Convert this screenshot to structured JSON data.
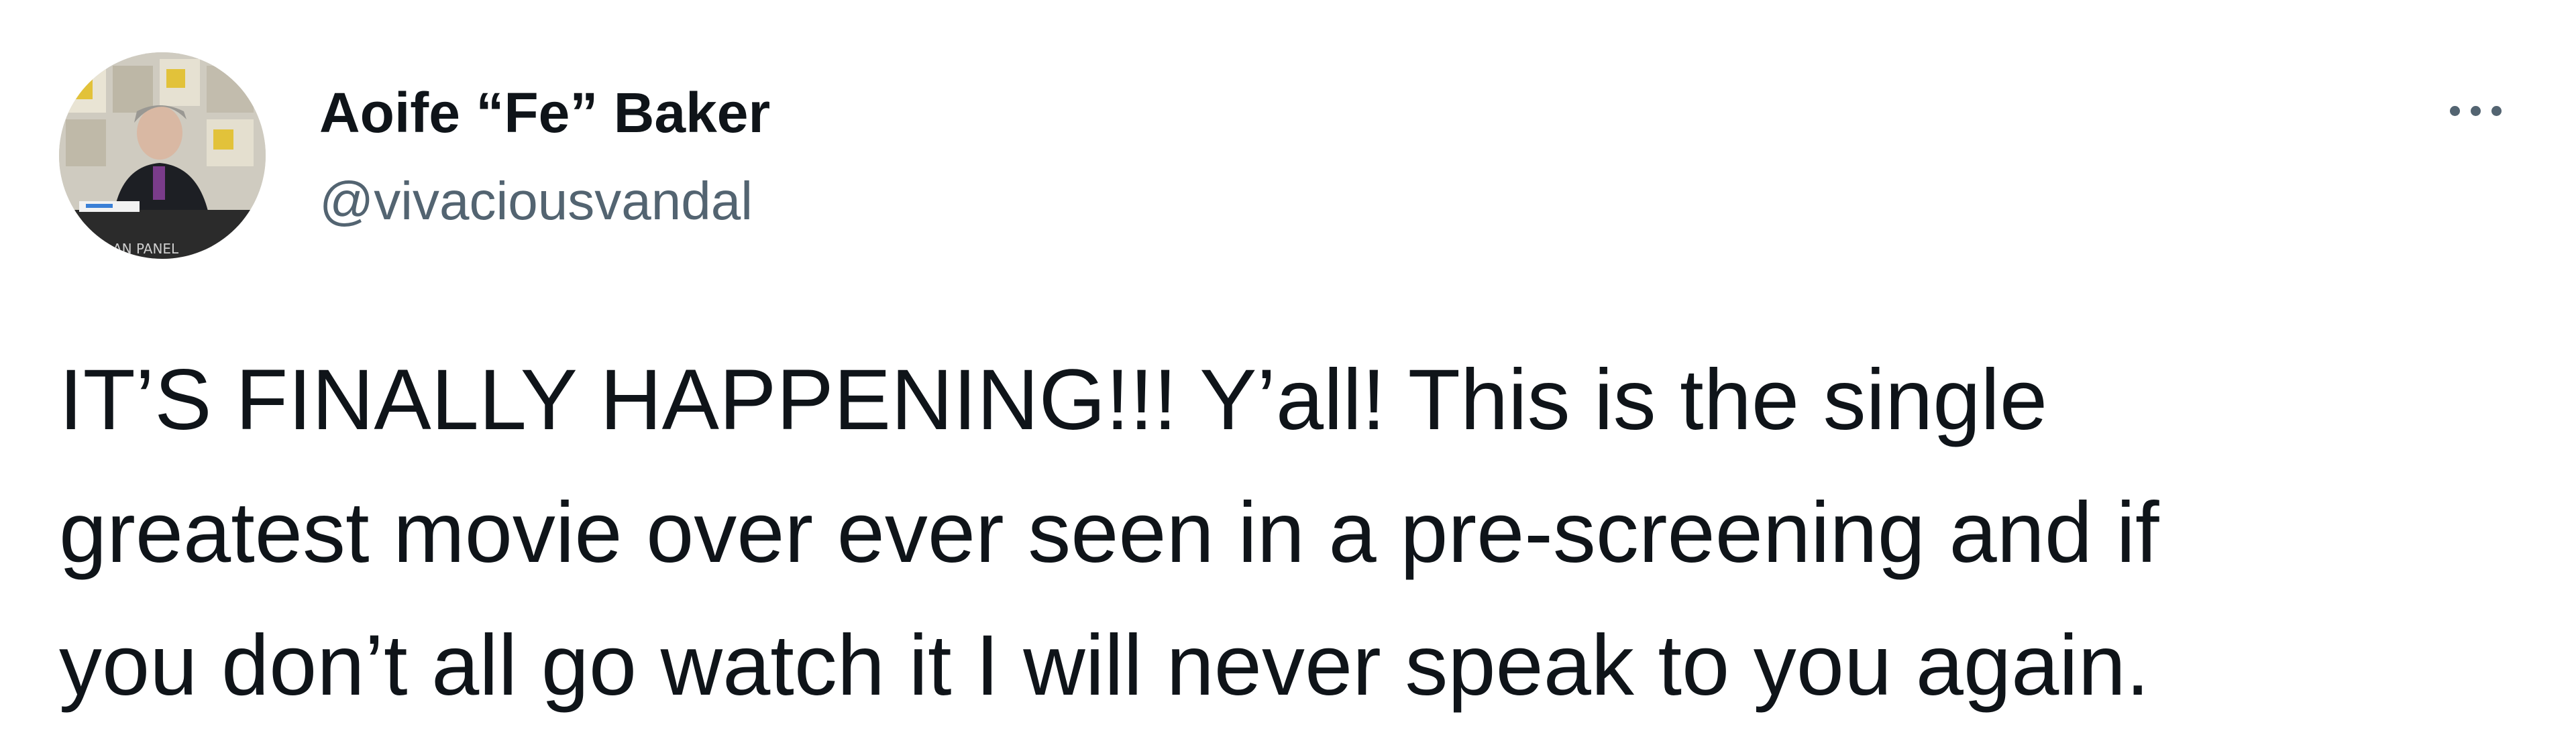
{
  "author": {
    "display_name": "Aoife “Fe” Baker",
    "handle": "@vivaciousvandal",
    "avatar_icon": "profile-photo"
  },
  "menu": {
    "more_icon": "more-horizontal-icon"
  },
  "tweet": {
    "lines": [
      "IT’S FINALLY HAPPENING!!! Y’all! This is the single",
      "greatest movie over ever seen in a pre-screening and if",
      "you don’t all go watch it I will never speak to you again."
    ]
  },
  "colors": {
    "text_primary": "#0f1419",
    "text_secondary": "#536471",
    "background": "#ffffff"
  }
}
